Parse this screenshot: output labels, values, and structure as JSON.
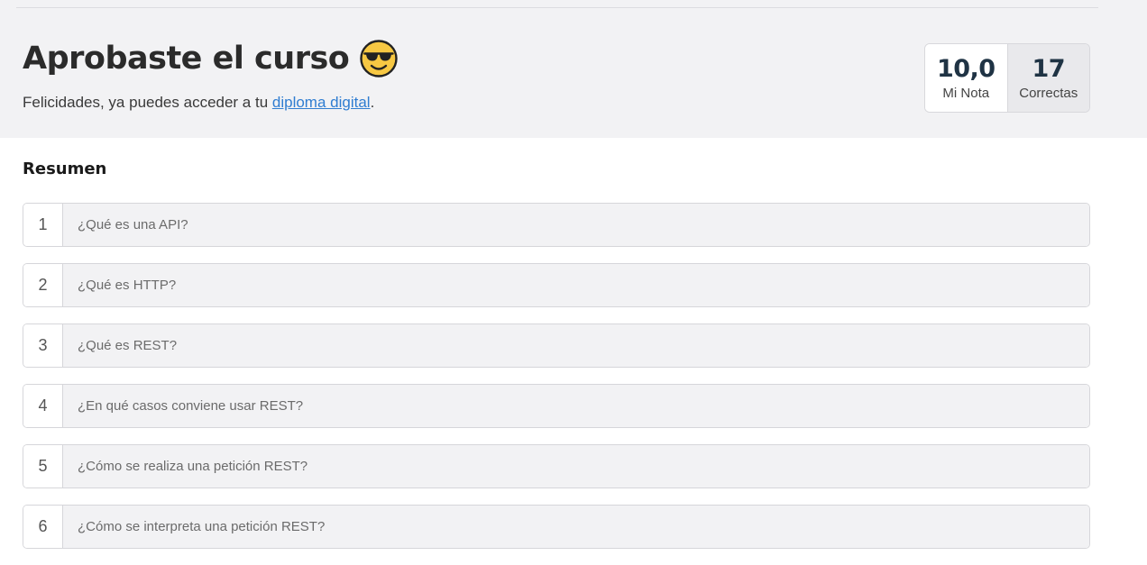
{
  "result": {
    "title": "Aprobaste el curso",
    "emoji_icon": "smiling-face-with-sunglasses-icon",
    "subtitle_prefix": "Felicidades, ya puedes acceder a tu ",
    "diploma_link": "diploma digital",
    "subtitle_suffix": "."
  },
  "score": {
    "grade_value": "10,0",
    "grade_label": "Mi Nota",
    "correct_value": "17",
    "correct_label": "Correctas"
  },
  "summary": {
    "heading": "Resumen",
    "questions": [
      {
        "number": "1",
        "text": "¿Qué es una API?"
      },
      {
        "number": "2",
        "text": "¿Qué es HTTP?"
      },
      {
        "number": "3",
        "text": "¿Qué es REST?"
      },
      {
        "number": "4",
        "text": "¿En qué casos conviene usar REST?"
      },
      {
        "number": "5",
        "text": "¿Cómo se realiza una petición REST?"
      },
      {
        "number": "6",
        "text": "¿Cómo se interpreta una petición REST?"
      }
    ]
  },
  "colors": {
    "header_bg": "#f2f2f4",
    "link": "#2f7dd1",
    "score_value": "#1f3344"
  }
}
